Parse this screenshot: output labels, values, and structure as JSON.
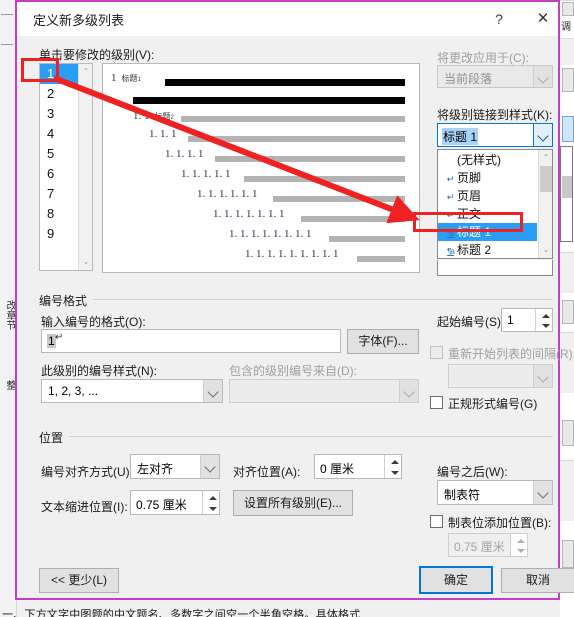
{
  "window": {
    "title": "定义新多级列表",
    "help_icon": "?",
    "close_icon": "✕"
  },
  "left": {
    "level_label": "单击要修改的级别(V):",
    "levels": [
      "1",
      "2",
      "3",
      "4",
      "5",
      "6",
      "7",
      "8",
      "9"
    ],
    "selected_level": "1",
    "scroll_up_icon": "⌃",
    "scroll_down_icon": "⌄"
  },
  "preview": {
    "rows": [
      {
        "num": "1",
        "style": "标题",
        "sup": "1"
      },
      {
        "num": "1. 1",
        "style": "标题",
        "sup": "2"
      },
      {
        "num": "1. 1. 1",
        "style": "",
        "sup": ""
      },
      {
        "num": "1. 1. 1. 1",
        "style": "",
        "sup": ""
      },
      {
        "num": "1. 1. 1. 1. 1",
        "style": "",
        "sup": ""
      },
      {
        "num": "1. 1. 1. 1. 1. 1",
        "style": "",
        "sup": ""
      },
      {
        "num": "1. 1. 1. 1. 1. 1. 1",
        "style": "",
        "sup": ""
      },
      {
        "num": "1. 1. 1. 1. 1. 1. 1. 1",
        "style": "",
        "sup": ""
      },
      {
        "num": "1. 1. 1. 1. 1. 1. 1. 1. 1",
        "style": "",
        "sup": ""
      }
    ]
  },
  "apply": {
    "label": "将更改应用于(C):",
    "value": "当前段落",
    "chevron_icon": "chevron-down"
  },
  "link_style": {
    "label": "将级别链接到样式(K):",
    "value": "标题 1",
    "chevron_icon": "chevron-down",
    "options": [
      {
        "icon": "",
        "label": "(无样式)"
      },
      {
        "icon": "↵",
        "label": "页脚"
      },
      {
        "icon": "↵",
        "label": "页眉"
      },
      {
        "icon": "↵",
        "label": "正文"
      },
      {
        "icon": "¶a",
        "label": "标题 1",
        "selected": true
      },
      {
        "icon": "¶a",
        "label": "标题 2"
      }
    ]
  },
  "number_format": {
    "group_label": "编号格式",
    "input_label": "输入编号的格式(O):",
    "input_value": "1",
    "input_mark": "↵",
    "font_button": "字体(F)...",
    "style_label": "此级别的编号样式(N):",
    "style_value": "1, 2, 3, ...",
    "include_label": "包含的级别编号来自(D):",
    "include_value": "",
    "start_label": "起始编号(S):",
    "start_value": "1",
    "restart_label": "重新开始列表的间隔(R):",
    "restart_checked": false,
    "restart_value": "",
    "legal_label": "正规形式编号(G)",
    "legal_checked": false
  },
  "position": {
    "group_label": "位置",
    "align_label": "编号对齐方式(U):",
    "align_value": "左对齐",
    "align_pos_label": "对齐位置(A):",
    "align_pos_value": "0 厘米",
    "indent_label": "文本缩进位置(I):",
    "indent_value": "0.75 厘米",
    "set_all_button": "设置所有级别(E)...",
    "after_number_label": "编号之后(W):",
    "after_number_value": "制表符",
    "tab_stop_label": "制表位添加位置(B):",
    "tab_stop_checked": false,
    "tab_stop_value": "0.75 厘米"
  },
  "footer": {
    "less_button": "<< 更少(L)",
    "ok_button": "确定",
    "cancel_button": "取消"
  },
  "annotation": {
    "arrow_color": "#ee2222",
    "box_color": "#ee2222"
  },
  "background": {
    "right_text": "调",
    "bottom_text": "一、下方文字中图题的中文题名、多数字之间空一个半角空格。具体格式"
  }
}
